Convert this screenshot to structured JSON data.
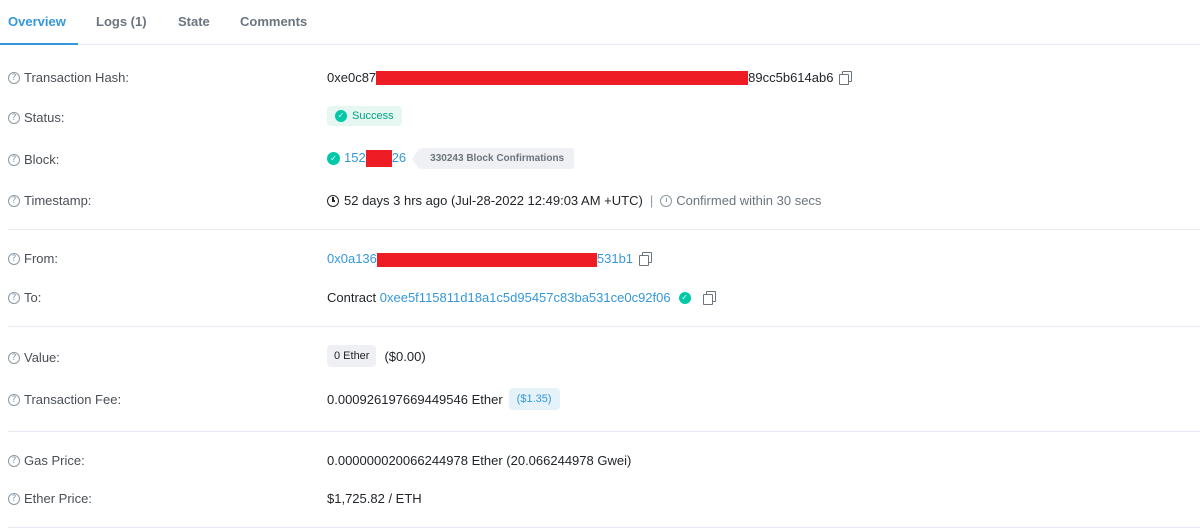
{
  "tabs": [
    {
      "label": "Overview",
      "active": true
    },
    {
      "label": "Logs (1)",
      "active": false
    },
    {
      "label": "State",
      "active": false
    },
    {
      "label": "Comments",
      "active": false
    }
  ],
  "rows": {
    "tx_hash": {
      "label": "Transaction Hash:",
      "prefix": "0xe0c87",
      "suffix": "89cc5b614ab6"
    },
    "status": {
      "label": "Status:",
      "value": "Success"
    },
    "block": {
      "label": "Block:",
      "prefix": "152",
      "suffix": "26",
      "confirmations": "330243 Block Confirmations"
    },
    "timestamp": {
      "label": "Timestamp:",
      "value": "52 days 3 hrs ago (Jul-28-2022 12:49:03 AM +UTC)",
      "separator": "|",
      "confirmed": "Confirmed within 30 secs"
    },
    "from": {
      "label": "From:",
      "prefix": "0x0a136",
      "suffix": "531b1"
    },
    "to": {
      "label": "To:",
      "kind": "Contract",
      "address": "0xee5f115811d18a1c5d95457c83ba531ce0c92f06"
    },
    "value": {
      "label": "Value:",
      "amount": "0 Ether",
      "usd": "($0.00)"
    },
    "fee": {
      "label": "Transaction Fee:",
      "amount": "0.000926197669449546 Ether",
      "usd": "($1.35)"
    },
    "gas_price": {
      "label": "Gas Price:",
      "value": "0.000000020066244978 Ether (20.066244978 Gwei)"
    },
    "ether_price": {
      "label": "Ether Price:",
      "value": "$1,725.82 / ETH"
    }
  },
  "colors": {
    "accent": "#3498db",
    "success": "#00c9a7",
    "redaction": "#ee1c25"
  },
  "icons": [
    "question-icon",
    "copy-icon",
    "check-circle-icon",
    "clock-icon",
    "timer-icon"
  ]
}
